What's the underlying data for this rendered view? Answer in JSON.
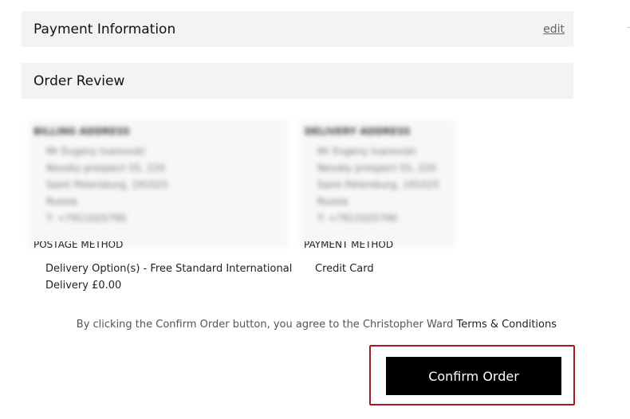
{
  "payment_section": {
    "title": "Payment Information",
    "edit_label": "edit"
  },
  "review_section": {
    "title": "Order Review"
  },
  "billing": {
    "heading": "BILLING ADDRESS",
    "lines": [
      "Mr Evgeny Ivanovski",
      "Nevsky prospect 55, 220",
      "Saint Petersburg, 191025",
      "Russia",
      "T: +7911025790"
    ]
  },
  "delivery": {
    "heading": "DELIVERY ADDRESS",
    "lines": [
      "Mr Evgeny Ivanovski",
      "Nevsky prospect 55, 220",
      "Saint Petersburg, 191025",
      "Russia",
      "T: +7911025790"
    ]
  },
  "postage": {
    "heading": "POSTAGE METHOD",
    "value": "Delivery Option(s) - Free Standard International Delivery £0.00"
  },
  "payment_method": {
    "heading": "PAYMENT METHOD",
    "value": "Credit Card"
  },
  "consent": {
    "text": "By clicking the Confirm Order button, you agree to the Christopher Ward ",
    "link_label": "Terms & Conditions"
  },
  "confirm_button_label": "Confirm Order",
  "colors": {
    "section_bg": "#f3f3f3",
    "button_bg": "#000000",
    "highlight_border": "#a8182b"
  }
}
